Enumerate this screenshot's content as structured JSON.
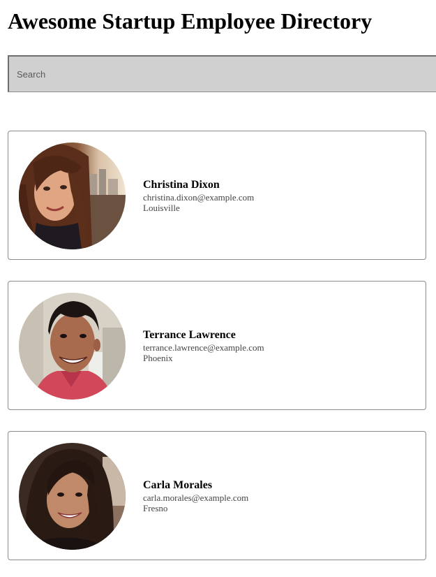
{
  "page": {
    "title": "Awesome Startup Employee Directory"
  },
  "search": {
    "placeholder": "Search",
    "value": ""
  },
  "employees": [
    {
      "name": "Christina Dixon",
      "email": "christina.dixon@example.com",
      "location": "Louisville"
    },
    {
      "name": "Terrance Lawrence",
      "email": "terrance.lawrence@example.com",
      "location": "Phoenix"
    },
    {
      "name": "Carla Morales",
      "email": "carla.morales@example.com",
      "location": "Fresno"
    }
  ]
}
